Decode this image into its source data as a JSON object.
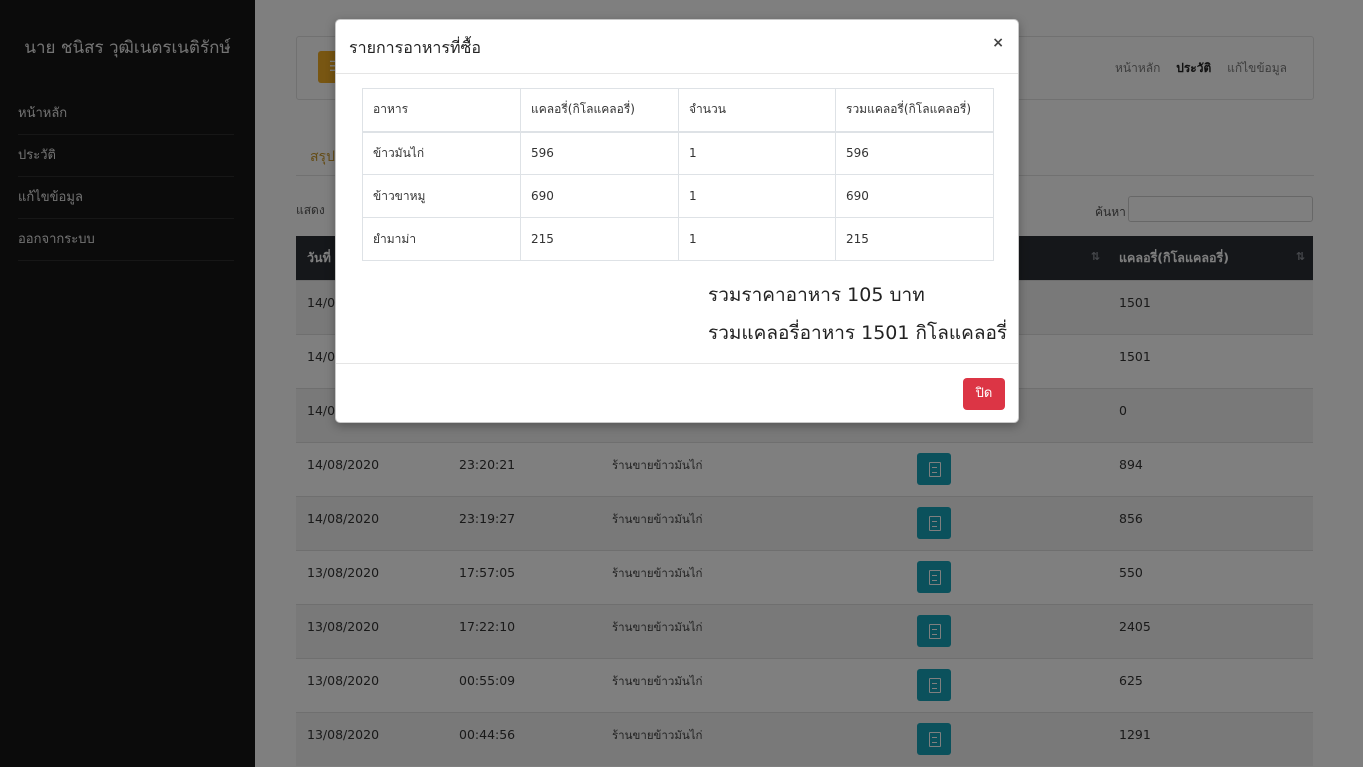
{
  "sidebar": {
    "user_name": "นาย ชนิสร วุฒิเนตรเนติรักษ์",
    "items": [
      {
        "label": "หน้าหลัก"
      },
      {
        "label": "ประวัติ"
      },
      {
        "label": "แก้ไขข้อมูล"
      },
      {
        "label": "ออกจากระบบ"
      }
    ]
  },
  "topnav": {
    "home": "หน้าหลัก",
    "history": "ประวัติ",
    "edit": "แก้ไขข้อมูล"
  },
  "main": {
    "section_title": "สรุป",
    "show_label": "แสดง",
    "search_label": "ค้นหา",
    "search_value": ""
  },
  "table": {
    "headers": [
      "วันที่",
      "",
      "",
      "",
      "แคลอรี่(กิโลแคลอรี่)"
    ],
    "rows": [
      {
        "date": "14/0",
        "time": "",
        "shop": "",
        "kcal": "1501",
        "button": false
      },
      {
        "date": "14/0",
        "time": "",
        "shop": "",
        "kcal": "1501",
        "button": false
      },
      {
        "date": "14/0",
        "time": "",
        "shop": "",
        "kcal": "0",
        "button": false
      },
      {
        "date": "14/08/2020",
        "time": "23:20:21",
        "shop": "ร้านขายข้าวมันไก่",
        "kcal": "894",
        "button": true
      },
      {
        "date": "14/08/2020",
        "time": "23:19:27",
        "shop": "ร้านขายข้าวมันไก่",
        "kcal": "856",
        "button": true
      },
      {
        "date": "13/08/2020",
        "time": "17:57:05",
        "shop": "ร้านขายข้าวมันไก่",
        "kcal": "550",
        "button": true
      },
      {
        "date": "13/08/2020",
        "time": "17:22:10",
        "shop": "ร้านขายข้าวมันไก่",
        "kcal": "2405",
        "button": true
      },
      {
        "date": "13/08/2020",
        "time": "00:55:09",
        "shop": "ร้านขายข้าวมันไก่",
        "kcal": "625",
        "button": true
      },
      {
        "date": "13/08/2020",
        "time": "00:44:56",
        "shop": "ร้านขายข้าวมันไก่",
        "kcal": "1291",
        "button": true
      }
    ]
  },
  "modal": {
    "title": "รายการอาหารที่ซื้อ",
    "close_symbol": "×",
    "headers": [
      "อาหาร",
      "แคลอรี่(กิโลแคลอรี่)",
      "จำนวน",
      "รวมแคลอรี่(กิโลแคลอรี่)"
    ],
    "items": [
      {
        "food": "ข้าวมันไก่",
        "kcal": "596",
        "qty": "1",
        "total": "596"
      },
      {
        "food": "ข้าวขาหมู",
        "kcal": "690",
        "qty": "1",
        "total": "690"
      },
      {
        "food": "ยำมาม่า",
        "kcal": "215",
        "qty": "1",
        "total": "215"
      }
    ],
    "summary_price": "รวมราคาอาหาร 105 บาท",
    "summary_kcal": "รวมแคลอรี่อาหาร 1501 กิโลแคลอรี่",
    "close_button": "ปิด"
  },
  "colors": {
    "sidebar": "#161616",
    "accent": "#f0ad24",
    "table_head": "#2b2f35",
    "doc_button": "#17a2b8",
    "danger": "#dc3545"
  }
}
